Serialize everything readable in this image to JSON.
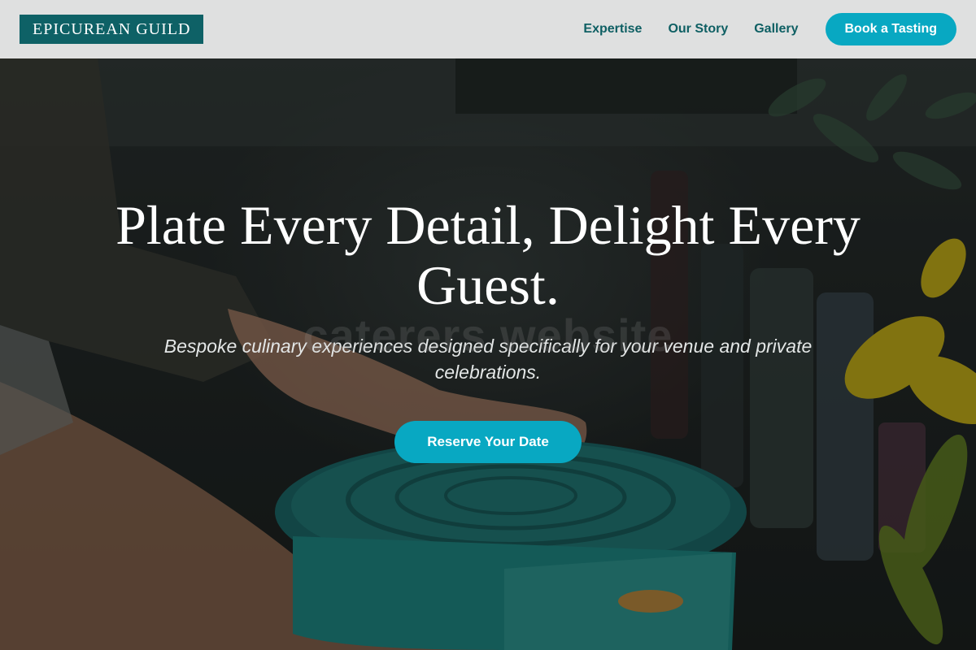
{
  "brand": {
    "logo_text": "EPICUREAN GUILD"
  },
  "nav": {
    "links": [
      {
        "label": "Expertise"
      },
      {
        "label": "Our Story"
      },
      {
        "label": "Gallery"
      }
    ],
    "cta_label": "Book a Tasting"
  },
  "hero": {
    "headline": "Plate Every Detail, Delight Every Guest.",
    "subtitle": "Bespoke culinary experiences designed specifically for your venue and private celebrations.",
    "button_label": "Reserve Your Date",
    "watermark_text": "caterers website",
    "background_image": "chef-lifting-teal-pot-lid-kitchen-icon"
  },
  "colors": {
    "brand_teal": "#0e6166",
    "accent_cyan": "#08a8c2",
    "header_bg": "#ececec",
    "nav_text": "#0e5f63"
  }
}
